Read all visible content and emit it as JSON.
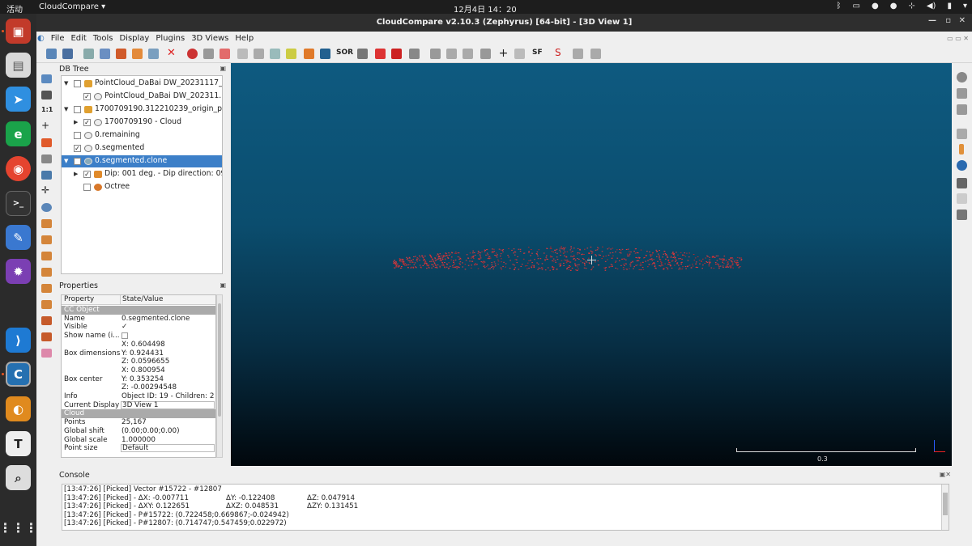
{
  "topbar": {
    "activities": "活动",
    "app": "CloudCompare ▾",
    "clock": "12月4日 14：20"
  },
  "title": "CloudCompare v2.10.3 (Zephyrus) [64-bit] - [3D View 1]",
  "menu": [
    "File",
    "Edit",
    "Tools",
    "Display",
    "Plugins",
    "3D Views",
    "Help"
  ],
  "db": {
    "title": "DB Tree",
    "rows": [
      {
        "label": "PointCloud_DaBai DW_20231117_...",
        "checked": false
      },
      {
        "label": "PointCloud_DaBai DW_202311...",
        "checked": true
      },
      {
        "label": "1700709190.312210239_origin_p...",
        "checked": false
      },
      {
        "label": "1700709190 - Cloud",
        "checked": true
      },
      {
        "label": "0.remaining",
        "checked": false
      },
      {
        "label": "0.segmented",
        "checked": true
      },
      {
        "label": "0.segmented.clone",
        "checked": false
      },
      {
        "label": "Dip: 001 deg. - Dip direction: 09...",
        "checked": true
      },
      {
        "label": "Octree",
        "checked": false
      }
    ]
  },
  "props": {
    "title": "Properties",
    "header_key": "Property",
    "header_val": "State/Value",
    "rows": [
      {
        "section": "CC Object"
      },
      {
        "k": "Name",
        "v": "0.segmented.clone"
      },
      {
        "k": "Visible",
        "v": "✓"
      },
      {
        "k": "Show name (i...",
        "v": ""
      },
      {
        "k": "",
        "v": "X: 0.604498"
      },
      {
        "k": "Box dimensions",
        "v": "Y: 0.924431"
      },
      {
        "k": "",
        "v": "Z: 0.0596655"
      },
      {
        "k": "",
        "v": "X: 0.800954"
      },
      {
        "k": "Box center",
        "v": "Y: 0.353254"
      },
      {
        "k": "",
        "v": "Z: -0.00294548"
      },
      {
        "k": "Info",
        "v": "Object ID: 19 - Children: 2"
      },
      {
        "k": "Current Display",
        "v": "3D View 1"
      },
      {
        "section": "Cloud"
      },
      {
        "k": "Points",
        "v": "25,167"
      },
      {
        "k": "Global shift",
        "v": "(0.00;0.00;0.00)"
      },
      {
        "k": "Global scale",
        "v": "1.000000"
      },
      {
        "k": "Point size",
        "v": "Default"
      }
    ]
  },
  "view": {
    "scale_label": "0.3"
  },
  "console": {
    "title": "Console",
    "lines": [
      {
        "c1": "[13:47:26] [Picked] Vector #15722 - #12807",
        "c2": "",
        "c3": ""
      },
      {
        "c1": "[13:47:26] [Picked]        - ΔX: -0.007711",
        "c2": "ΔY: -0.122408",
        "c3": "ΔZ: 0.047914"
      },
      {
        "c1": "[13:47:26] [Picked]        - ΔXY: 0.122651",
        "c2": "ΔXZ: 0.048531",
        "c3": "ΔZY: 0.131451"
      },
      {
        "c1": "[13:47:26] [Picked]        - P#15722: (0.722458;0.669867;-0.024942)",
        "c2": "",
        "c3": ""
      },
      {
        "c1": "[13:47:26] [Picked]        - P#12807: (0.714747;0.547459;0.022972)",
        "c2": "",
        "c3": ""
      }
    ]
  }
}
